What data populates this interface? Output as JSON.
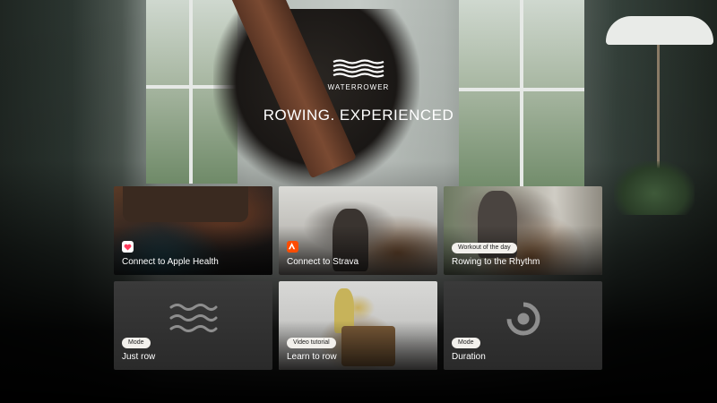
{
  "brand": {
    "logo_text": "WATERROWER"
  },
  "headline": "ROWING. EXPERIENCED",
  "cards": [
    {
      "title": "Connect to Apple Health",
      "badge_icon": "heart-icon",
      "badge_color": "#ff3b5c"
    },
    {
      "title": "Connect to Strava",
      "badge_icon": "strava-icon",
      "badge_color": "#fc4c02"
    },
    {
      "title": "Rowing to the Rhythm",
      "tag": "Workout of the day"
    },
    {
      "title": "Just row",
      "tag": "Mode",
      "icon": "waves-icon"
    },
    {
      "title": "Learn to row",
      "tag": "Video tutorial"
    },
    {
      "title": "Duration",
      "tag": "Mode",
      "icon": "progress-ring-icon"
    }
  ]
}
